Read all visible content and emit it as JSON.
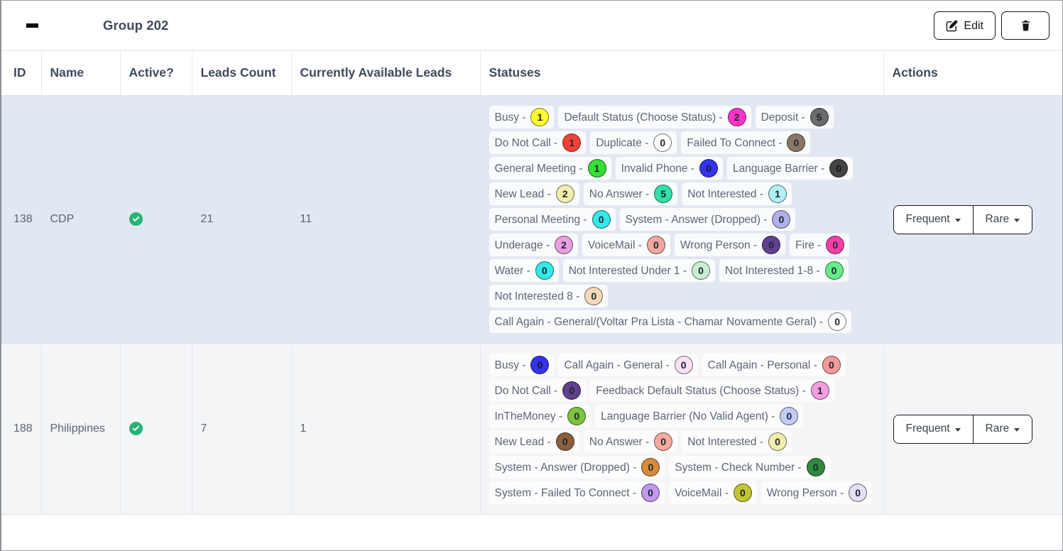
{
  "header": {
    "collapse_icon": "minus-icon",
    "title": "Group 202",
    "edit_label": "Edit",
    "edit_icon": "edit-pencil-icon",
    "delete_icon": "trash-icon"
  },
  "table": {
    "columns": [
      {
        "key": "id",
        "label": "ID"
      },
      {
        "key": "name",
        "label": "Name"
      },
      {
        "key": "active",
        "label": "Active?"
      },
      {
        "key": "leads_count",
        "label": "Leads Count"
      },
      {
        "key": "available_leads",
        "label": "Currently Available Leads"
      },
      {
        "key": "statuses",
        "label": "Statuses"
      },
      {
        "key": "actions",
        "label": "Actions"
      }
    ],
    "rows": [
      {
        "id": "138",
        "name": "CDP",
        "active": true,
        "active_icon": "check-circle-icon",
        "leads_count": "21",
        "available_leads": "11",
        "actions": {
          "frequent_label": "Frequent",
          "rare_label": "Rare"
        },
        "statuses": [
          {
            "label": "Busy -",
            "count": "1",
            "color": "#ffff33"
          },
          {
            "label": "Default Status (Choose Status) -",
            "count": "2",
            "color": "#ff33cc"
          },
          {
            "label": "Deposit -",
            "count": "5",
            "color": "#6b6b6b"
          },
          {
            "label": "Do Not Call -",
            "count": "1",
            "color": "#f44336"
          },
          {
            "label": "Duplicate -",
            "count": "0",
            "color": "#ffffff"
          },
          {
            "label": "Failed To Connect -",
            "count": "0",
            "color": "#8a7765"
          },
          {
            "label": "General Meeting -",
            "count": "1",
            "color": "#33e033"
          },
          {
            "label": "Invalid Phone -",
            "count": "0",
            "color": "#3333ee"
          },
          {
            "label": "Language Barrier -",
            "count": "0",
            "color": "#444444"
          },
          {
            "label": "New Lead -",
            "count": "2",
            "color": "#f0eead"
          },
          {
            "label": "No Answer -",
            "count": "5",
            "color": "#33e0a8"
          },
          {
            "label": "Not Interested -",
            "count": "1",
            "color": "#b0f0f5"
          },
          {
            "label": "Personal Meeting -",
            "count": "0",
            "color": "#33e8e8"
          },
          {
            "label": "System - Answer (Dropped) -",
            "count": "0",
            "color": "#b0b0e8"
          },
          {
            "label": "Underage -",
            "count": "2",
            "color": "#e8a0e0"
          },
          {
            "label": "VoiceMail -",
            "count": "0",
            "color": "#f0a8a0"
          },
          {
            "label": "Wrong Person -",
            "count": "0",
            "color": "#60408c"
          },
          {
            "label": "Fire -",
            "count": "0",
            "color": "#f53fa8"
          },
          {
            "label": "Water -",
            "count": "0",
            "color": "#33e8e8"
          },
          {
            "label": "Not Interested Under 1 -",
            "count": "0",
            "color": "#c8f0d0"
          },
          {
            "label": "Not Interested 1-8 -",
            "count": "0",
            "color": "#66ee88"
          },
          {
            "label": "Not Interested 8 -",
            "count": "0",
            "color": "#f5d9b8"
          },
          {
            "label": "Call Again - General/(Voltar Pra Lista - Chamar Novamente Geral) -",
            "count": "0",
            "color": "#ffffff"
          }
        ]
      },
      {
        "id": "188",
        "name": "Philippines",
        "active": true,
        "active_icon": "check-circle-icon",
        "leads_count": "7",
        "available_leads": "1",
        "actions": {
          "frequent_label": "Frequent",
          "rare_label": "Rare"
        },
        "statuses": [
          {
            "label": "Busy -",
            "count": "0",
            "color": "#3333ee"
          },
          {
            "label": "Call Again - General -",
            "count": "0",
            "color": "#fbe0f3"
          },
          {
            "label": "Call Again - Personal -",
            "count": "0",
            "color": "#f59898"
          },
          {
            "label": "Do Not Call -",
            "count": "0",
            "color": "#60408c"
          },
          {
            "label": "Feedback Default Status (Choose Status) -",
            "count": "1",
            "color": "#f49de0"
          },
          {
            "label": "InTheMoney -",
            "count": "0",
            "color": "#7ac43f"
          },
          {
            "label": "Language Barrier (No Valid Agent) -",
            "count": "0",
            "color": "#c2cdf5"
          },
          {
            "label": "New Lead -",
            "count": "0",
            "color": "#8a5f3d"
          },
          {
            "label": "No Answer -",
            "count": "0",
            "color": "#f7a9a0"
          },
          {
            "label": "Not Interested -",
            "count": "0",
            "color": "#f0eead"
          },
          {
            "label": "System - Answer (Dropped) -",
            "count": "0",
            "color": "#d98b35"
          },
          {
            "label": "System - Check Number -",
            "count": "0",
            "color": "#2f8a40"
          },
          {
            "label": "System - Failed To Connect -",
            "count": "0",
            "color": "#c497f0"
          },
          {
            "label": "VoiceMail -",
            "count": "0",
            "color": "#c2c433"
          },
          {
            "label": "Wrong Person -",
            "count": "0",
            "color": "#e6ddf7"
          }
        ]
      }
    ]
  }
}
